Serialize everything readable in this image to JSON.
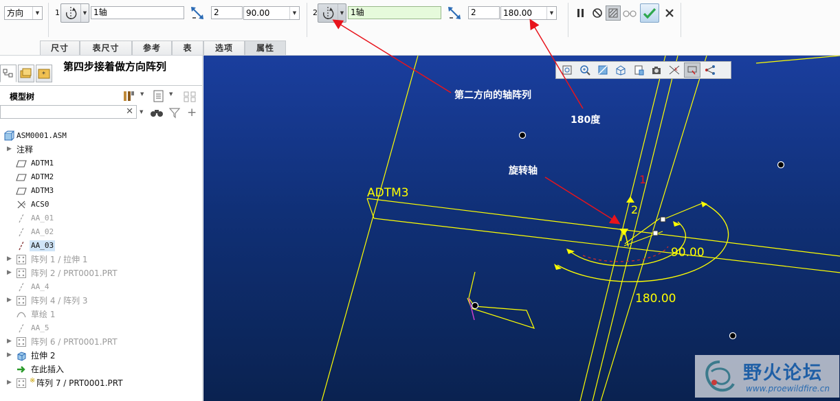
{
  "toolbar": {
    "type_dropdown": "方向",
    "dir1": {
      "number": "1",
      "reference": "1轴",
      "count": "2",
      "angle": "90.00"
    },
    "dir2": {
      "number": "2",
      "reference": "1轴",
      "count": "2",
      "angle": "180.00"
    }
  },
  "tabs": [
    "尺寸",
    "表尺寸",
    "参考",
    "表",
    "选项",
    "属性"
  ],
  "left_panel": {
    "step_title": "第四步接着做方向阵列",
    "tree_title": "模型树",
    "tree": [
      {
        "label": "ASM0001.ASM",
        "icon": "assembly-icon",
        "kind": "root"
      },
      {
        "label": "注释",
        "icon": "",
        "kind": "group"
      },
      {
        "label": "ADTM1",
        "icon": "datum-plane-icon",
        "kind": "normal"
      },
      {
        "label": "ADTM2",
        "icon": "datum-plane-icon",
        "kind": "normal"
      },
      {
        "label": "ADTM3",
        "icon": "datum-plane-icon",
        "kind": "normal"
      },
      {
        "label": "ACS0",
        "icon": "coordinate-system-icon",
        "kind": "normal"
      },
      {
        "label": "AA_01",
        "icon": "datum-axis-icon",
        "kind": "dim"
      },
      {
        "label": "AA_02",
        "icon": "datum-axis-icon",
        "kind": "dim"
      },
      {
        "label": "AA_03",
        "icon": "datum-axis-icon",
        "kind": "selected"
      },
      {
        "label": "阵列 1 / 拉伸 1",
        "icon": "pattern-icon",
        "kind": "dim-exp"
      },
      {
        "label": "阵列 2 / PRT0001.PRT",
        "icon": "pattern-icon",
        "kind": "dim-exp"
      },
      {
        "label": "AA_4",
        "icon": "datum-axis-icon",
        "kind": "dim"
      },
      {
        "label": "阵列 4 / 阵列 3",
        "icon": "pattern-icon",
        "kind": "dim-exp"
      },
      {
        "label": "草绘 1",
        "icon": "sketch-icon",
        "kind": "dim"
      },
      {
        "label": "AA_5",
        "icon": "datum-axis-icon",
        "kind": "dim"
      },
      {
        "label": "阵列 6 / PRT0001.PRT",
        "icon": "pattern-icon",
        "kind": "dim-exp"
      },
      {
        "label": "拉伸 2",
        "icon": "extrude-icon",
        "kind": "exp"
      },
      {
        "label": "在此插入",
        "icon": "insert-here-icon",
        "kind": "normal"
      },
      {
        "label": "阵列 7 / PRT0001.PRT",
        "icon": "pattern-icon",
        "kind": "exp-star"
      }
    ]
  },
  "graphics": {
    "plane_label": "ADTM3",
    "dim_90": "90.00",
    "dim_180": "180.00",
    "dir_label_1": "1",
    "dir_label_2": "2",
    "watermark": {
      "name": "野火论坛",
      "url": "www.proewildfire.cn"
    }
  },
  "annotations": {
    "second_direction": "第二方向的轴阵列",
    "angle_180": "180度",
    "rotation_axis": "旋转轴"
  },
  "colors": {
    "geometry": "#ffff00",
    "annotation_arrow": "#e8141c",
    "active_field": "#e6fadb",
    "confirm": "#2fa84f"
  }
}
